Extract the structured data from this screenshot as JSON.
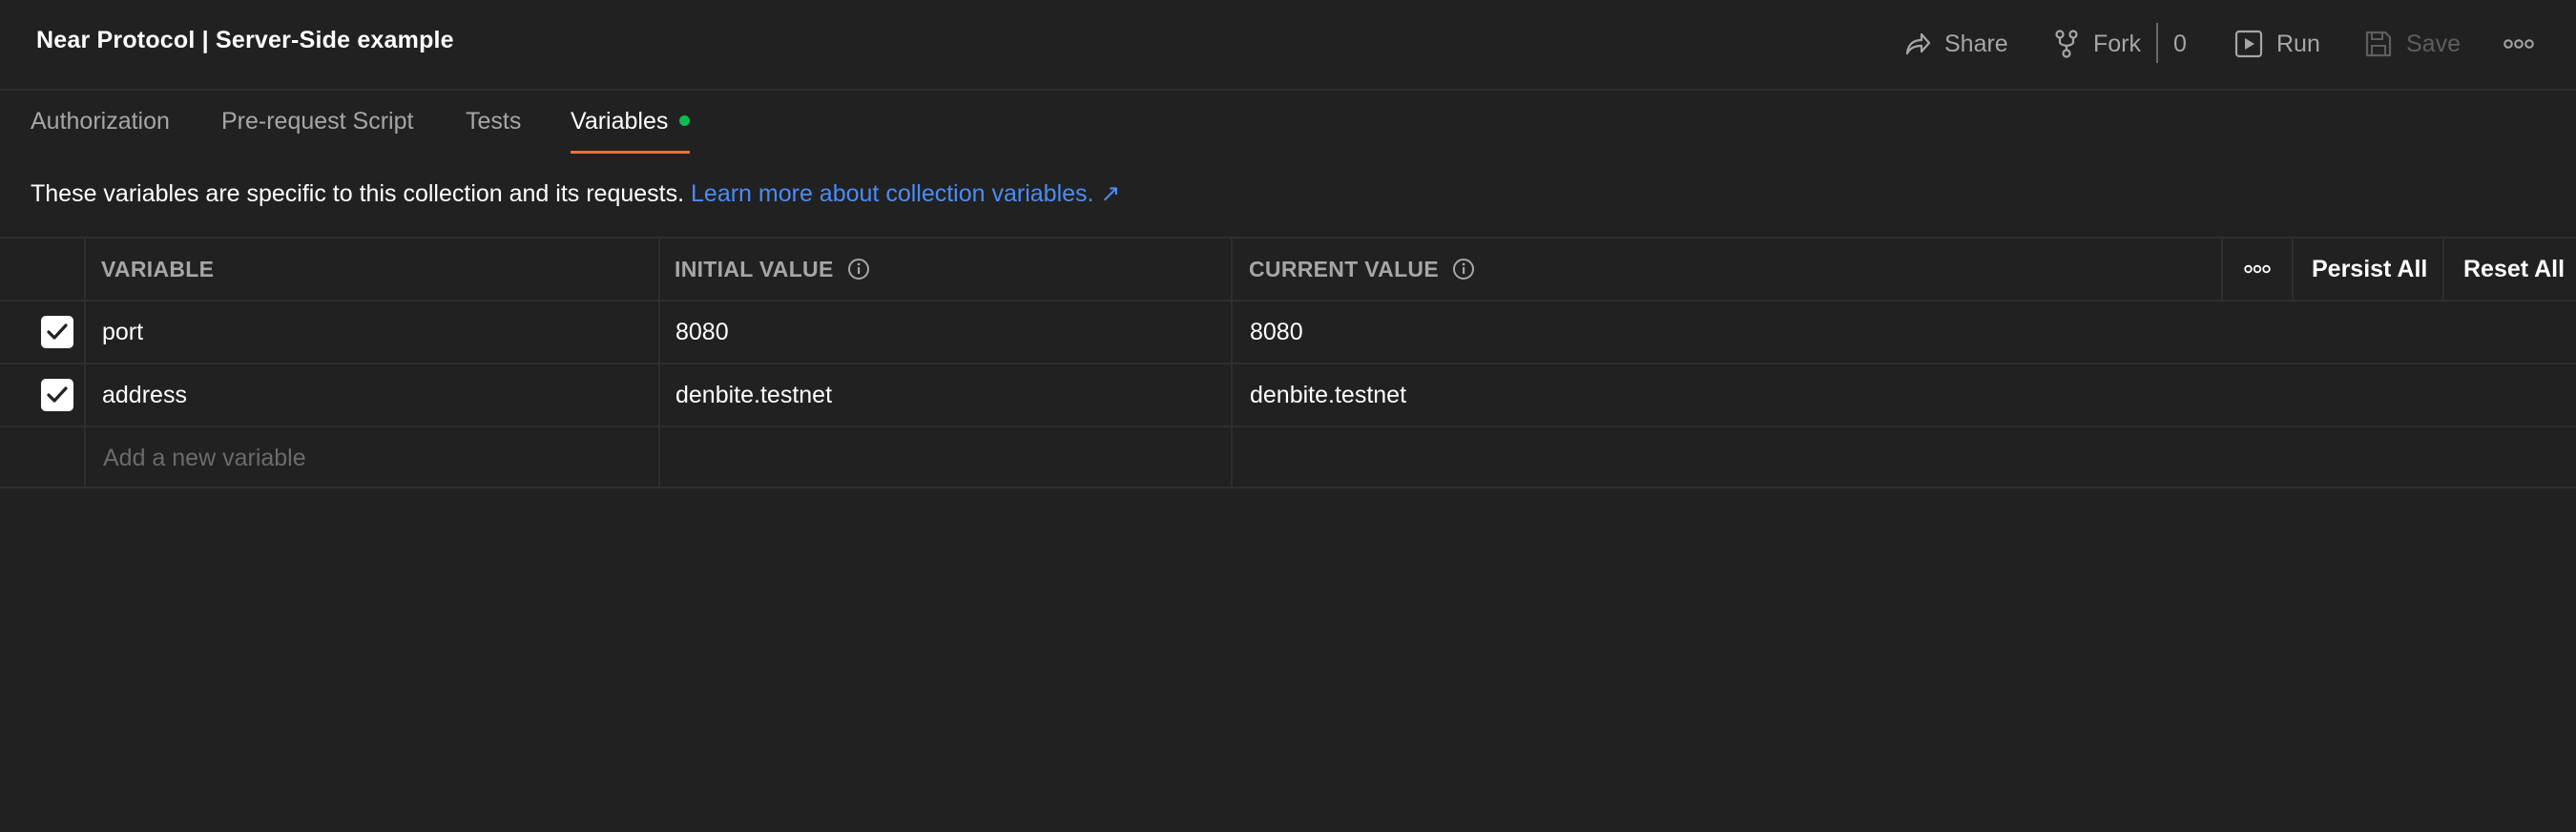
{
  "header": {
    "title": "Near Protocol | Server-Side example",
    "share_label": "Share",
    "fork_label": "Fork",
    "fork_count": "0",
    "run_label": "Run",
    "save_label": "Save"
  },
  "tabs": [
    {
      "label": "Authorization",
      "active": false
    },
    {
      "label": "Pre-request Script",
      "active": false
    },
    {
      "label": "Tests",
      "active": false
    },
    {
      "label": "Variables",
      "active": true
    }
  ],
  "info": {
    "text": "These variables are specific to this collection and its requests.",
    "link": "Learn more about collection variables. ↗"
  },
  "table": {
    "columns": [
      "VARIABLE",
      "INITIAL VALUE",
      "CURRENT VALUE"
    ],
    "persist_all": "Persist All",
    "reset_all": "Reset All",
    "rows": [
      {
        "checked": true,
        "variable": "port",
        "initial": "8080",
        "current": "8080"
      },
      {
        "checked": true,
        "variable": "address",
        "initial": "denbite.testnet",
        "current": "denbite.testnet"
      }
    ],
    "new_placeholder": "Add a new variable"
  },
  "colors": {
    "background": "#212121",
    "accent_tab": "#ff6c37",
    "link": "#4b8cf5",
    "status_dot": "#0cbb52"
  }
}
